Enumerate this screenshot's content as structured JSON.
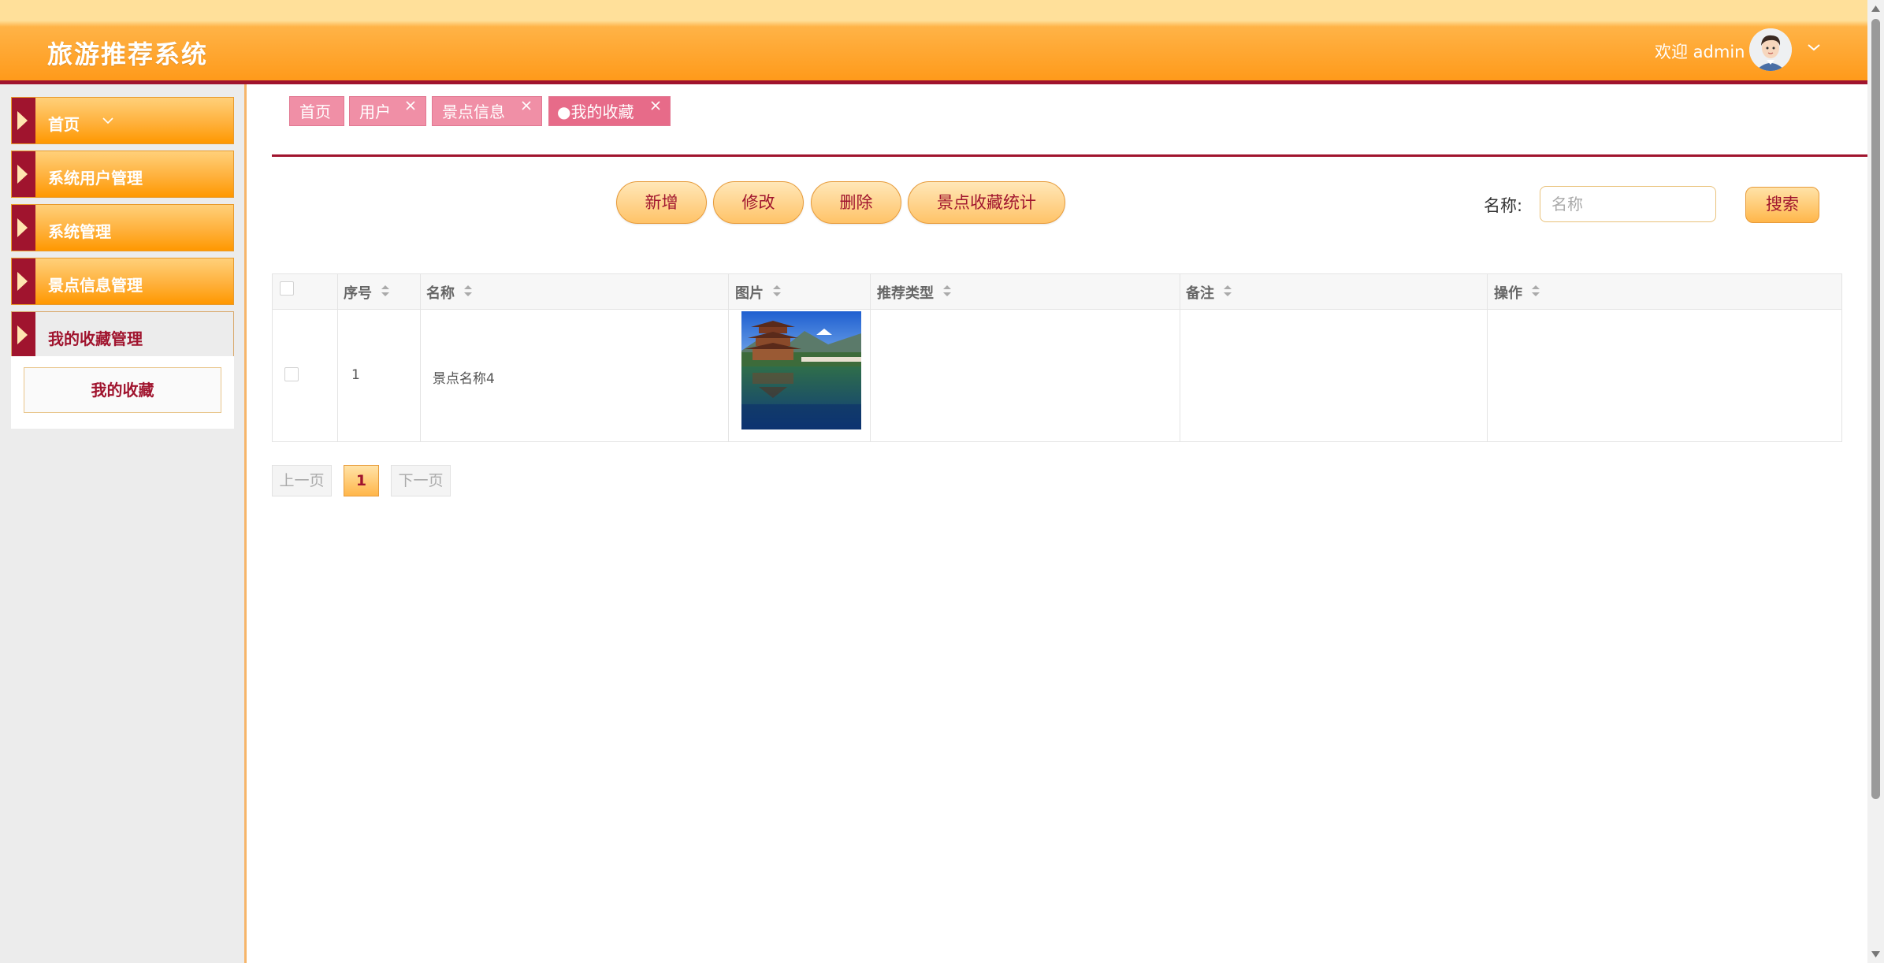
{
  "header": {
    "app_title": "旅游推荐系统",
    "welcome_text": "欢迎 admin"
  },
  "sidebar": {
    "items": [
      {
        "label": "首页"
      },
      {
        "label": "系统用户管理"
      },
      {
        "label": "系统管理"
      },
      {
        "label": "景点信息管理"
      },
      {
        "label": "我的收藏管理"
      }
    ],
    "active_submenu": {
      "label": "我的收藏"
    }
  },
  "tabs": [
    {
      "label": "首页"
    },
    {
      "label": "用户"
    },
    {
      "label": "景点信息"
    },
    {
      "label": "●我的收藏"
    }
  ],
  "toolbar": {
    "add_label": "新增",
    "edit_label": "修改",
    "delete_label": "删除",
    "stats_label": "景点收藏统计"
  },
  "search": {
    "label": "名称:",
    "placeholder": "名称",
    "value": "",
    "button_label": "搜索"
  },
  "table": {
    "columns": [
      "序号",
      "名称",
      "图片",
      "推荐类型",
      "备注",
      "操作"
    ],
    "rows": [
      {
        "index": "1",
        "name": "景点名称4",
        "image": "pagoda-lake-photo",
        "type": "",
        "remark": "",
        "actions": ""
      }
    ]
  },
  "pagination": {
    "prev_label": "上一页",
    "current_page": "1",
    "next_label": "下一页"
  },
  "colors": {
    "accent": "#a0142e",
    "header_orange": "#ff9a1a",
    "tab_pink": "#f08fa6"
  }
}
